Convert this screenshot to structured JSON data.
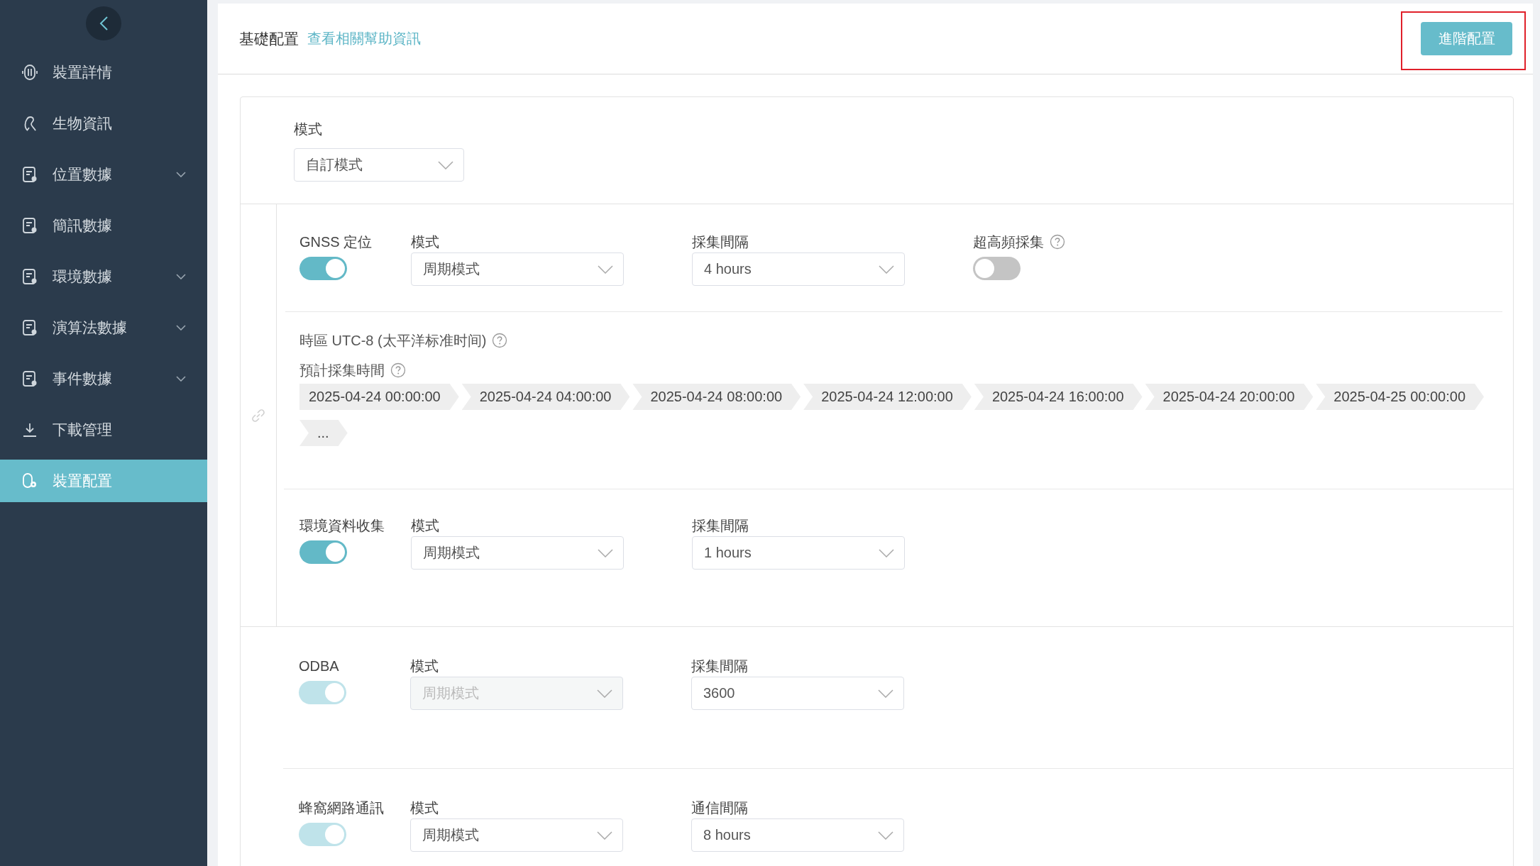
{
  "sidebar": {
    "items": [
      {
        "label": "裝置詳情",
        "expandable": false,
        "selected": false
      },
      {
        "label": "生物資訊",
        "expandable": false,
        "selected": false
      },
      {
        "label": "位置數據",
        "expandable": true,
        "selected": false
      },
      {
        "label": "簡訊數據",
        "expandable": false,
        "selected": false
      },
      {
        "label": "環境數據",
        "expandable": true,
        "selected": false
      },
      {
        "label": "演算法數據",
        "expandable": true,
        "selected": false
      },
      {
        "label": "事件數據",
        "expandable": true,
        "selected": false
      },
      {
        "label": "下載管理",
        "expandable": false,
        "selected": false
      },
      {
        "label": "裝置配置",
        "expandable": false,
        "selected": true
      }
    ]
  },
  "header": {
    "title": "基礎配置",
    "help_link": "查看相關幫助資訊",
    "advanced_button": {
      "label": "進階配置",
      "highlighted": true
    }
  },
  "mode": {
    "label": "模式",
    "value": "自訂模式"
  },
  "linked_group": {
    "sections": [
      {
        "name": "GNSS 定位",
        "on": true,
        "disabled": false,
        "fields": [
          {
            "kind": "select",
            "label": "模式",
            "value": "周期模式",
            "disabled": false
          },
          {
            "kind": "select",
            "label": "採集間隔",
            "value": "4 hours",
            "disabled": false
          },
          {
            "kind": "toggle",
            "label": "超高頻採集",
            "help": true,
            "on": false
          }
        ],
        "schedule": {
          "timezone": "時區 UTC-8 (太平洋标准时间)",
          "label": "預計採集時間",
          "times": [
            "2025-04-24 00:00:00",
            "2025-04-24 04:00:00",
            "2025-04-24 08:00:00",
            "2025-04-24 12:00:00",
            "2025-04-24 16:00:00",
            "2025-04-24 20:00:00",
            "2025-04-25 00:00:00",
            "..."
          ]
        }
      },
      {
        "name": "環境資料收集",
        "on": true,
        "disabled": false,
        "fields": [
          {
            "kind": "select",
            "label": "模式",
            "value": "周期模式",
            "disabled": false
          },
          {
            "kind": "select",
            "label": "採集間隔",
            "value": "1 hours",
            "disabled": false
          }
        ]
      }
    ]
  },
  "sections": [
    {
      "name": "ODBA",
      "on": true,
      "disabled": true,
      "fields": [
        {
          "kind": "select",
          "label": "模式",
          "value": "周期模式",
          "disabled": true
        },
        {
          "kind": "select",
          "label": "採集間隔",
          "value": "3600",
          "disabled": false
        }
      ]
    },
    {
      "name": "蜂窩網路通訊",
      "on": true,
      "disabled": true,
      "fields": [
        {
          "kind": "select",
          "label": "模式",
          "value": "周期模式",
          "disabled": false
        },
        {
          "kind": "select",
          "label": "通信間隔",
          "value": "8 hours",
          "disabled": false
        }
      ]
    }
  ]
}
